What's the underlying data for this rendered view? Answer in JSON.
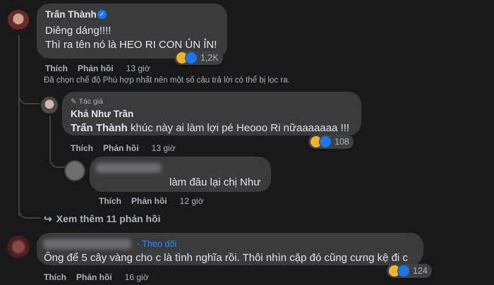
{
  "c1": {
    "author": "Trấn Thành",
    "lines": [
      "Diêng dáng!!!!",
      "Thì ra tên nó là HEO RI CON ỦN ỈN!"
    ],
    "reactions": "1,2K",
    "like": "Thích",
    "reply": "Phản hồi",
    "time": "13 giờ",
    "filter_note": "Đã chọn chế độ Phù hợp nhất nên một số câu trả lời có thể bị lọc ra."
  },
  "r1": {
    "badge": "Tác giả",
    "author": "Khả Như Trần",
    "mention": "Trấn Thành",
    "text": " khúc này ai làm lợi pé Heooo Ri nữaaaaaaa !!!",
    "reactions": "108",
    "like": "Thích",
    "reply": "Phản hồi",
    "time": "13 giờ"
  },
  "r2": {
    "text": "làm đâu lại chị Như",
    "like": "Thích",
    "reply": "Phản hồi",
    "time": "12 giờ"
  },
  "more_replies": "Xem thêm 11 phản hồi",
  "c2": {
    "follow": "Theo dõi",
    "text": "Ông để 5 cây vàng cho c là tình nghĩa rồi. Thôi nhìn cặp đó cũng cưng kệ đi c",
    "reactions": "124",
    "like": "Thích",
    "reply": "Phản hồi",
    "time": "16 giờ"
  }
}
